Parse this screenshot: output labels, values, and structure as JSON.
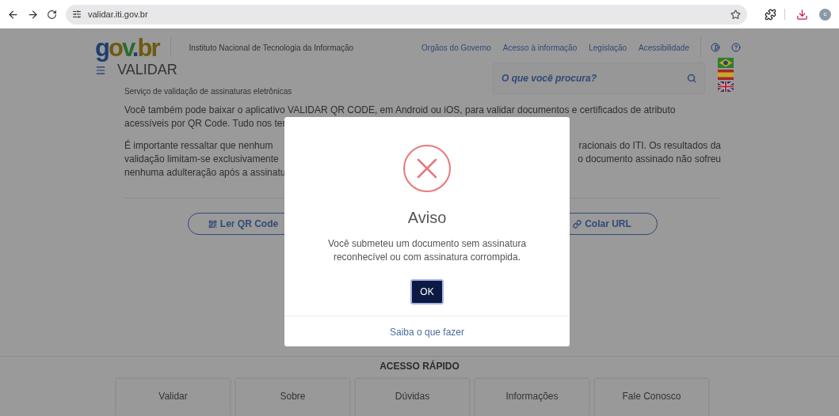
{
  "browser": {
    "url": "validar.iti.gov.br",
    "avatar": "c"
  },
  "header": {
    "logo": {
      "gov": "gov",
      "dot": ".",
      "br": "br"
    },
    "institute": "Instituto Nacional de Tecnologia da Informação",
    "links": [
      "Orgãos do Governo",
      "Acesso à informação",
      "Legislação",
      "Acessibilidade"
    ],
    "title": "VALIDAR",
    "subtitle": "Serviço de validação de assinaturas eletrônicas",
    "search": {
      "placeholder": "O que você procura?"
    }
  },
  "content": {
    "line_full": "Você também pode baixar o aplicativo VALIDAR QR CODE, em Android ou iOS, para validar documentos e certificados de atributo",
    "rows": [
      {
        "left": "acessíveis por QR Code. Tudo nos ter"
      },
      {
        "left": "É importante ressaltar que nenhum",
        "right": "racionais do ITI. Os resultados da"
      },
      {
        "left": "validação limitam-se exclusivamente",
        "right": "o documento assinado não sofreu"
      },
      {
        "left": "nenhuma adulteração após a assinatu"
      }
    ],
    "buttons": [
      {
        "label": "Ler QR Code",
        "kind": "qr"
      },
      {
        "label": "Colar URL",
        "kind": "link"
      }
    ]
  },
  "quick_access": {
    "title": "ACESSO RÁPIDO",
    "items": [
      "Validar",
      "Sobre",
      "Dúvidas",
      "Informações",
      "Fale Conosco"
    ]
  },
  "dialog": {
    "title": "Aviso",
    "message": "Você submeteu um documento sem assinatura reconhecível ou com assinatura corrompida.",
    "ok": "OK",
    "help_link": "Saiba o que fazer"
  }
}
